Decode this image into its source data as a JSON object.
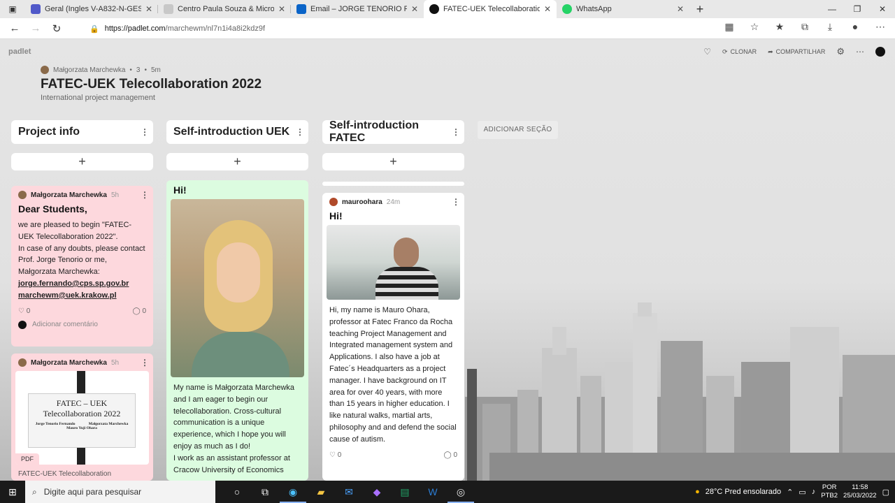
{
  "browser": {
    "tabs": [
      {
        "title": "Geral (Ingles V-A832-N-GESTAO",
        "color": "#5059c9"
      },
      {
        "title": "Centro Paula Souza & Microsoft",
        "color": "#c8c8c8"
      },
      {
        "title": "Email – JORGE TENORIO FERNA",
        "color": "#0a64c8"
      },
      {
        "title": "FATEC-UEK Telecollaboration 202",
        "color": "#111111"
      },
      {
        "title": "WhatsApp",
        "color": "#25d366"
      }
    ],
    "new_tab": "+",
    "url_host": "https://padlet.com",
    "url_path": "/marchewm/nl7n1i4a8i2kdz9f"
  },
  "padlet": {
    "brand": "padlet",
    "clone_label": "CLONAR",
    "share_label": "COMPARTILHAR",
    "author": "Małgorzata Marchewka",
    "likes": "3",
    "age": "5m",
    "title": "FATEC-UEK Telecollaboration 2022",
    "subtitle": "International project management",
    "add_section": "ADICIONAR SEÇÃO",
    "columns": [
      {
        "title": "Project info"
      },
      {
        "title": "Self-introduction UEK"
      },
      {
        "title": "Self-introduction FATEC"
      }
    ],
    "add_post": "+"
  },
  "cards": {
    "info1": {
      "author": "Małgorzata Marchewka",
      "time": "5h",
      "title": "Dear Students,",
      "body": "we are  pleased to begin \"FATEC-UEK Telecollaboration 2022\".\nIn case of any doubts, please contact Prof. Jorge Tenorio or me, Małgorzata Marchewka:",
      "email1": "jorge.fernando@cps.sp.gov.br",
      "email2": "marchewm@uek.krakow.pl",
      "likes": "0",
      "comments": "0",
      "add_comment": "Adicionar comentário"
    },
    "info2": {
      "author": "Małgorzata Marchewka",
      "time": "5h",
      "pdf_title1": "FATEC – UEK",
      "pdf_title2": "Telecollaboration 2022",
      "pdf_name1": "Jorge Tenorio Fernando",
      "pdf_name2": "Małgorzata Marchewka",
      "pdf_name3": "Mauro Yuji Ohara",
      "pdf_badge": "PDF",
      "caption": "FATEC-UEK Telecollaboration"
    },
    "uek": {
      "title": "Hi!",
      "body": "My name is Małgorzata Marchewka and I am eager to begin our telecollaboration. Cross-cultural communication is a unique experience, which I hope you will enjoy as much as I do!\nI work as an assistant professor at Cracow University of Economics"
    },
    "fatec": {
      "author": "mauroohara",
      "time": "24m",
      "title": "Hi!",
      "body": "Hi, my name is Mauro Ohara, professor at Fatec Franco da Rocha teaching Project Management and Integrated management system and Applications. I also have a job at Fatec´s Headquarters as a project manager. I have background on IT area for over 40 years, with more than 15 years in higher education. I like natural walks, martial arts, philosophy and and defend the social cause of autism.",
      "likes": "0",
      "comments": "0"
    }
  },
  "taskbar": {
    "search_placeholder": "Digite aqui para pesquisar",
    "weather": "28°C  Pred ensolarado",
    "lang1": "POR",
    "lang2": "PTB2",
    "time": "11:58",
    "date": "25/03/2022"
  }
}
